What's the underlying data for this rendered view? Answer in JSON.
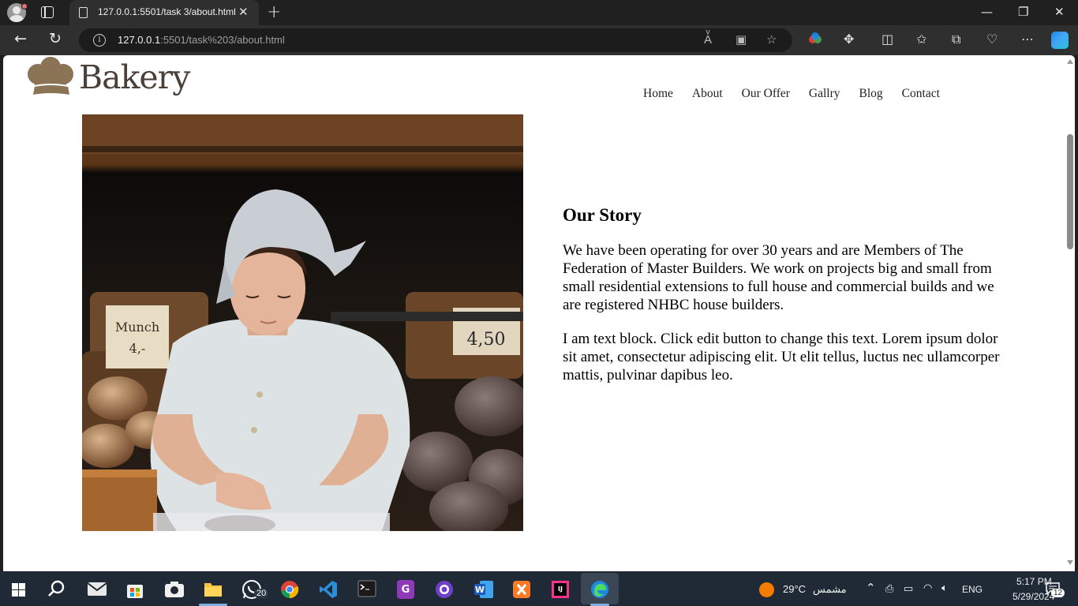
{
  "browser": {
    "tab_title": "127.0.0.1:5501/task 3/about.html",
    "url_host": "127.0.0.1",
    "url_rest": ":5501/task%203/about.html"
  },
  "site": {
    "logo_text": "Bakery",
    "nav": [
      "Home",
      "About",
      "Our Offer",
      "Gallry",
      "Blog",
      "Contact"
    ],
    "brand_color": "#8b7355"
  },
  "story": {
    "heading": "Our Story",
    "paragraph1": "We have been operating for over 30 years and are Members of The Federation of Master Builders. We work on projects big and small from small residential extensions to full house and commercial builds and we are registered NHBC house builders.",
    "paragraph2": "I am text block. Click edit button to change this text. Lorem ipsum dolor sit amet, consectetur adipiscing elit. Ut elit tellus, luctus nec ullamcorper mattis, pulvinar dapibus leo."
  },
  "taskbar": {
    "whatsapp_badge": "20",
    "weather_temp": "29°C",
    "weather_text": "مشمس",
    "language": "ENG",
    "time": "5:17 PM",
    "date": "5/29/2024",
    "notifications": "12"
  }
}
